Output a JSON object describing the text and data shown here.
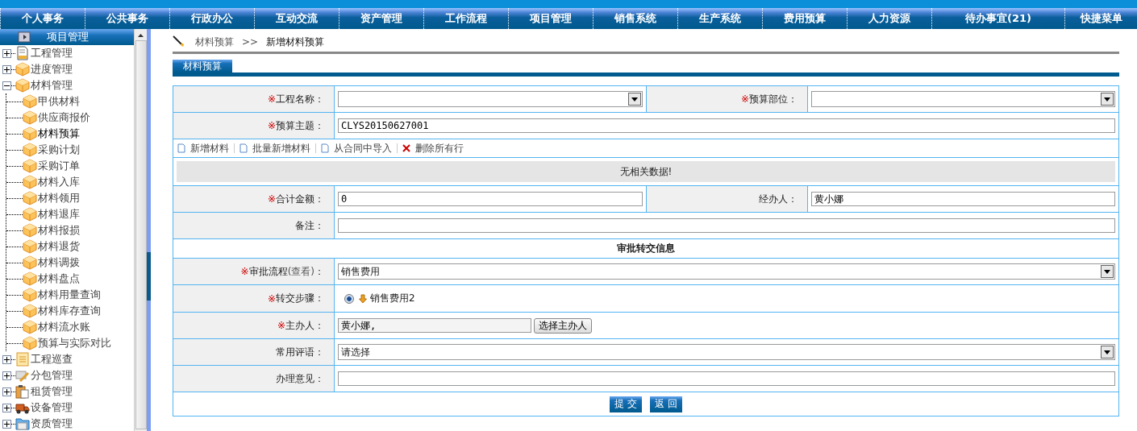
{
  "nav": [
    "个人事务",
    "公共事务",
    "行政办公",
    "互动交流",
    "资产管理",
    "工作流程",
    "项目管理",
    "销售系统",
    "生产系统",
    "费用预算",
    "人力资源",
    "待办事宜(21)",
    "快捷菜单"
  ],
  "sidebar": {
    "title": "项目管理",
    "items": [
      {
        "label": "工程管理",
        "kind": "doc",
        "expanded": false
      },
      {
        "label": "进度管理",
        "kind": "box",
        "expanded": false
      },
      {
        "label": "材料管理",
        "kind": "box",
        "expanded": true,
        "children": [
          {
            "label": "甲供材料",
            "kind": "box",
            "selected": false
          },
          {
            "label": "供应商报价",
            "kind": "box",
            "selected": false
          },
          {
            "label": "材料预算",
            "kind": "box",
            "selected": true
          },
          {
            "label": "采购计划",
            "kind": "box",
            "selected": false
          },
          {
            "label": "采购订单",
            "kind": "box",
            "selected": false
          },
          {
            "label": "材料入库",
            "kind": "box",
            "selected": false
          },
          {
            "label": "材料领用",
            "kind": "box",
            "selected": false
          },
          {
            "label": "材料退库",
            "kind": "box",
            "selected": false
          },
          {
            "label": "材料报损",
            "kind": "box",
            "selected": false
          },
          {
            "label": "材料退货",
            "kind": "box",
            "selected": false
          },
          {
            "label": "材料调拨",
            "kind": "box",
            "selected": false
          },
          {
            "label": "材料盘点",
            "kind": "box",
            "selected": false
          },
          {
            "label": "材料用量查询",
            "kind": "box",
            "selected": false
          },
          {
            "label": "材料库存查询",
            "kind": "box",
            "selected": false
          },
          {
            "label": "材料流水账",
            "kind": "box",
            "selected": false
          },
          {
            "label": "预算与实际对比",
            "kind": "box",
            "selected": false
          }
        ]
      },
      {
        "label": "工程巡查",
        "kind": "note",
        "expanded": false
      },
      {
        "label": "分包管理",
        "kind": "tools",
        "expanded": false
      },
      {
        "label": "租赁管理",
        "kind": "clipboard",
        "expanded": false
      },
      {
        "label": "设备管理",
        "kind": "truck",
        "expanded": false
      },
      {
        "label": "资质管理",
        "kind": "folder",
        "expanded": false
      }
    ]
  },
  "breadcrumb": [
    "材料预算",
    ">>",
    "新增材料预算"
  ],
  "tab": "材料预算",
  "form": [
    {
      "kind": "pair",
      "fields": [
        {
          "label": "工程名称：",
          "required": true,
          "kind": "select"
        },
        {
          "label": "预算部位：",
          "required": true,
          "kind": "select"
        }
      ]
    },
    {
      "kind": "single",
      "field": {
        "label": "预算主题：",
        "required": true,
        "kind": "text",
        "value": "CLYS20150627001"
      }
    },
    {
      "kind": "toolbar",
      "actions": [
        {
          "label": "新增材料",
          "kind": "doc"
        },
        {
          "label": "批量新增材料",
          "kind": "doc"
        },
        {
          "label": "从合同中导入",
          "kind": "doc"
        },
        {
          "label": "删除所有行",
          "kind": "delete"
        }
      ]
    },
    {
      "kind": "empty",
      "text": "无相关数据!"
    },
    {
      "kind": "pair",
      "fields": [
        {
          "label": "合计金额：",
          "required": true,
          "kind": "text",
          "value": "0"
        },
        {
          "label": "经办人：",
          "required": false,
          "kind": "text",
          "value": "黄小娜"
        }
      ]
    },
    {
      "kind": "single",
      "field": {
        "label": "备注：",
        "required": false,
        "kind": "text"
      }
    },
    {
      "kind": "section",
      "text": "审批转交信息"
    },
    {
      "kind": "single",
      "field": {
        "label": "审批流程",
        "link": "(查看)",
        "suffix": "：",
        "required": true,
        "kind": "select",
        "value": "销售费用"
      }
    },
    {
      "kind": "radio",
      "label": "转交步骤：",
      "required": true,
      "options": [
        {
          "label": "销售费用2",
          "selected": true
        }
      ]
    },
    {
      "kind": "person",
      "label": "主办人：",
      "required": true,
      "value": "黄小娜,",
      "button": "选择主办人"
    },
    {
      "kind": "single",
      "field": {
        "label": "常用评语：",
        "required": false,
        "kind": "select",
        "value": "请选择"
      }
    },
    {
      "kind": "single",
      "field": {
        "label": "办理意见：",
        "required": false,
        "kind": "text"
      }
    }
  ],
  "buttons": [
    "提 交",
    "返 回"
  ],
  "required_mark": "※"
}
